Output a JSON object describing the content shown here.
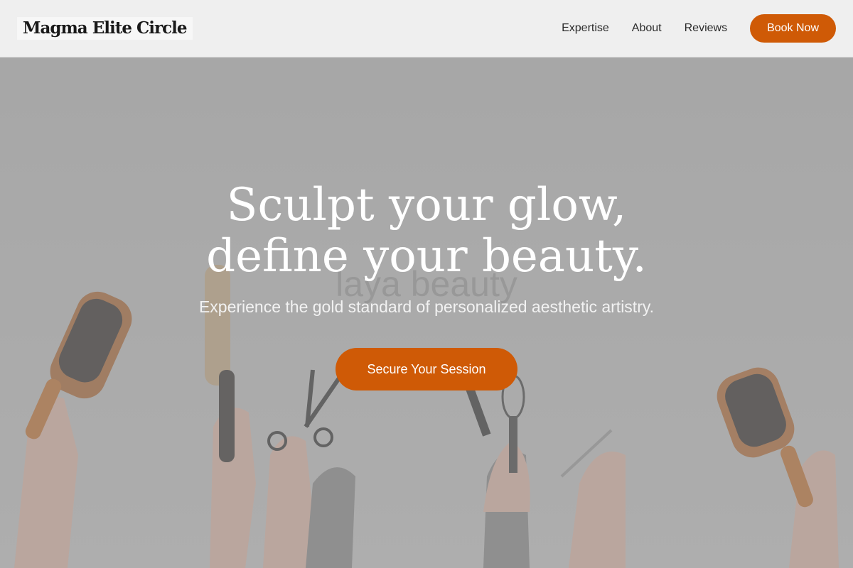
{
  "header": {
    "logo": "Magma Elite Circle",
    "nav": [
      {
        "label": "Expertise"
      },
      {
        "label": "About"
      },
      {
        "label": "Reviews"
      }
    ],
    "book_label": "Book Now"
  },
  "hero": {
    "headline_line1": "Sculpt your glow,",
    "headline_line2": "define your beauty.",
    "subheadline": "Experience the gold standard of personalized aesthetic artistry.",
    "cta_label": "Secure Your Session",
    "background_watermark": "laya beauty"
  },
  "colors": {
    "accent": "#cf5a06",
    "header_bg": "#efefef",
    "hero_overlay": "#a9a9a9"
  },
  "icons": [
    "paddle-brush-icon",
    "round-brush-icon",
    "scissors-icon",
    "tint-brush-icon",
    "whisk-icon",
    "thinning-shears-icon"
  ]
}
